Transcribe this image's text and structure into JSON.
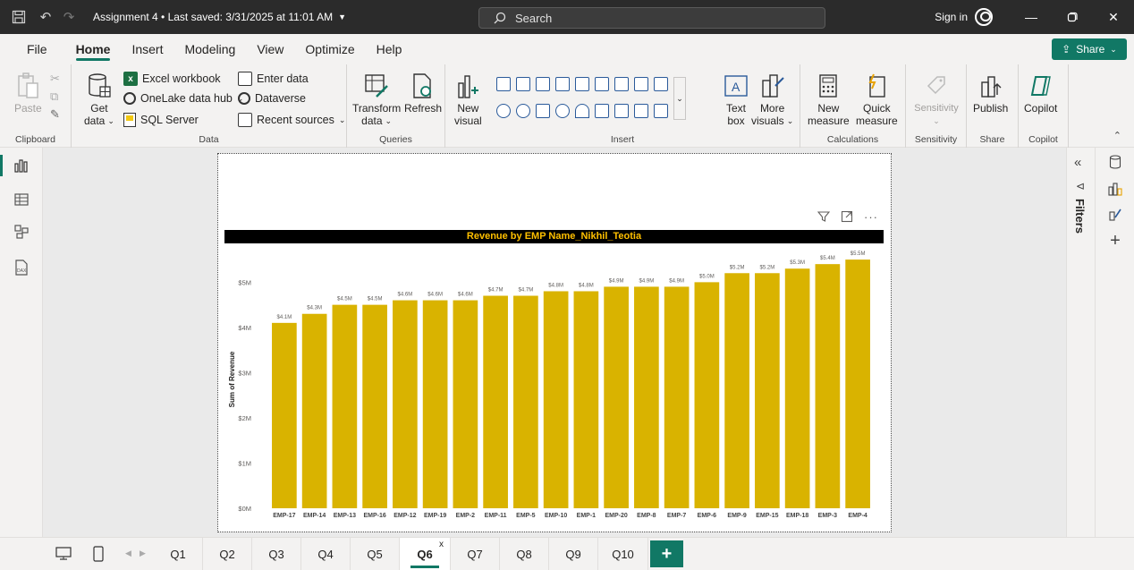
{
  "titlebar": {
    "title": "Assignment 4 • Last saved: 3/31/2025 at 11:01 AM",
    "search_placeholder": "Search",
    "sign_in": "Sign in"
  },
  "menu": {
    "tabs": [
      "File",
      "Home",
      "Insert",
      "Modeling",
      "View",
      "Optimize",
      "Help"
    ],
    "active": "Home",
    "share_label": "Share"
  },
  "ribbon": {
    "clipboard": {
      "paste": "Paste",
      "label": "Clipboard"
    },
    "data": {
      "get_data_1": "Get",
      "get_data_2": "data",
      "excel": "Excel workbook",
      "onelake": "OneLake data hub",
      "sql": "SQL Server",
      "enter_data": "Enter data",
      "dataverse": "Dataverse",
      "recent": "Recent sources",
      "label": "Data"
    },
    "queries": {
      "transform_1": "Transform",
      "transform_2": "data",
      "refresh": "Refresh",
      "label": "Queries"
    },
    "insert": {
      "new_visual_1": "New",
      "new_visual_2": "visual",
      "text_box_1": "Text",
      "text_box_2": "box",
      "more_visuals_1": "More",
      "more_visuals_2": "visuals",
      "label": "Insert"
    },
    "calculations": {
      "new_measure_1": "New",
      "new_measure_2": "measure",
      "quick_measure_1": "Quick",
      "quick_measure_2": "measure",
      "label": "Calculations"
    },
    "sensitivity": {
      "btn": "Sensitivity",
      "label": "Sensitivity"
    },
    "share": {
      "publish": "Publish",
      "label": "Share"
    },
    "copilot": {
      "btn": "Copilot",
      "label": "Copilot"
    }
  },
  "filters_label": "Filters",
  "pages": {
    "tabs": [
      "Q1",
      "Q2",
      "Q3",
      "Q4",
      "Q5",
      "Q6",
      "Q7",
      "Q8",
      "Q9",
      "Q10"
    ],
    "active": "Q6",
    "add_label": "+"
  },
  "colors": {
    "accent": "#117865",
    "bar": "#d9b300",
    "title_bg": "#000000",
    "title_text": "#ffc000"
  },
  "chart_data": {
    "type": "bar",
    "title": "Revenue by EMP Name_Nikhil_Teotia",
    "xlabel": "",
    "ylabel": "Sum of Revenue",
    "categories": [
      "EMP-17",
      "EMP-14",
      "EMP-13",
      "EMP-16",
      "EMP-12",
      "EMP-19",
      "EMP-2",
      "EMP-11",
      "EMP-5",
      "EMP-10",
      "EMP-1",
      "EMP-20",
      "EMP-8",
      "EMP-7",
      "EMP-6",
      "EMP-9",
      "EMP-15",
      "EMP-18",
      "EMP-3",
      "EMP-4"
    ],
    "values": [
      4.1,
      4.3,
      4.5,
      4.5,
      4.6,
      4.6,
      4.6,
      4.7,
      4.7,
      4.8,
      4.8,
      4.9,
      4.9,
      4.9,
      5.0,
      5.2,
      5.2,
      5.3,
      5.4,
      5.5
    ],
    "data_labels": [
      "$4.1M",
      "$4.3M",
      "$4.5M",
      "$4.5M",
      "$4.6M",
      "$4.6M",
      "$4.6M",
      "$4.7M",
      "$4.7M",
      "$4.8M",
      "$4.8M",
      "$4.9M",
      "$4.9M",
      "$4.9M",
      "$5.0M",
      "$5.2M",
      "$5.2M",
      "$5.3M",
      "$5.4M",
      "$5.5M"
    ],
    "ylim": [
      0,
      5.7
    ],
    "yticks": [
      0,
      1,
      2,
      3,
      4,
      5
    ],
    "ytick_labels": [
      "$0M",
      "$1M",
      "$2M",
      "$3M",
      "$4M",
      "$5M"
    ],
    "grid": false,
    "legend": "none"
  }
}
